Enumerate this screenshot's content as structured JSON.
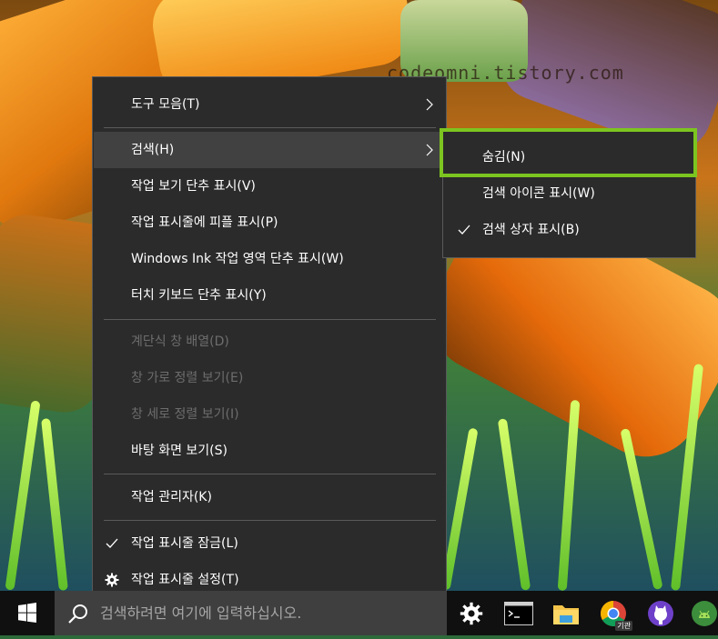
{
  "watermark": "codeomni.tistory.com",
  "context_menu": {
    "items": [
      {
        "label": "도구 모음(T)"
      },
      {
        "label": "검색(H)"
      },
      {
        "label": "작업 보기 단추 표시(V)"
      },
      {
        "label": "작업 표시줄에 피플 표시(P)"
      },
      {
        "label": "Windows Ink 작업 영역 단추 표시(W)"
      },
      {
        "label": "터치 키보드 단추 표시(Y)"
      },
      {
        "label": "계단식 창 배열(D)"
      },
      {
        "label": "창 가로 정렬 보기(E)"
      },
      {
        "label": "창 세로 정렬 보기(I)"
      },
      {
        "label": "바탕 화면 보기(S)"
      },
      {
        "label": "작업 관리자(K)"
      },
      {
        "label": "작업 표시줄 잠금(L)"
      },
      {
        "label": "작업 표시줄 설정(T)"
      }
    ]
  },
  "search_submenu": {
    "items": [
      {
        "label": "숨김(N)"
      },
      {
        "label": "검색 아이콘 표시(W)"
      },
      {
        "label": "검색 상자 표시(B)"
      }
    ]
  },
  "taskbar": {
    "search_placeholder": "검색하려면 여기에 입력하십시오.",
    "chrome_badge": "기관"
  },
  "colors": {
    "menu_bg": "#2b2b2b",
    "hover_bg": "#414141",
    "disabled_text": "#6d6d6d",
    "highlight_border": "#7cc520",
    "taskbar_bg": "#101010",
    "search_bg": "#3f3f3f"
  },
  "icons": {
    "submenu_arrow": "chevron-right-icon",
    "checked": "checkmark-icon",
    "settings": "gear-icon",
    "start": "windows-logo-icon",
    "search": "search-icon"
  }
}
